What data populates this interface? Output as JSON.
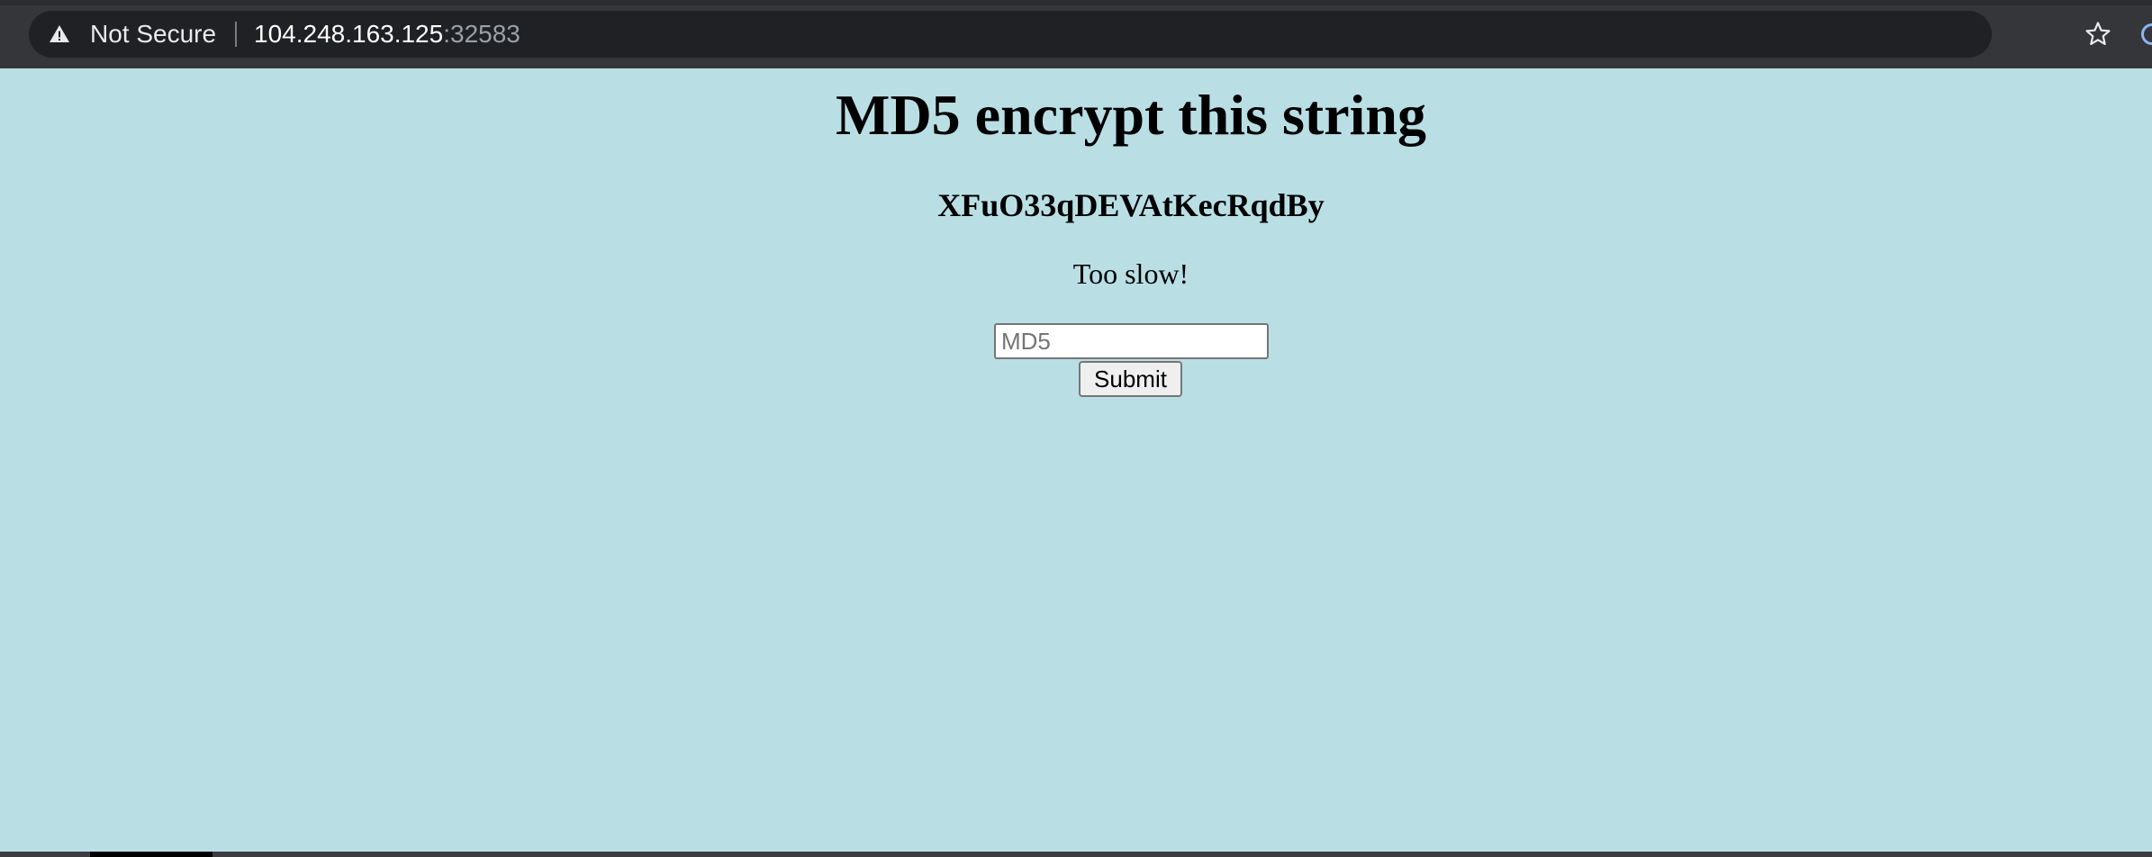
{
  "browser": {
    "security_label": "Not Secure",
    "url_host": "104.248.163.125",
    "url_port": ":32583",
    "icons": {
      "security": "warning-triangle-icon",
      "bookmark": "star-icon",
      "extension": "extension-icon"
    }
  },
  "page": {
    "background_color": "#b9dfe5",
    "heading": "MD5 encrypt this string",
    "challenge_string": "XFuO33qDEVAtKecRqdBy",
    "status_message": "Too slow!",
    "form": {
      "input_placeholder": "MD5",
      "input_value": "",
      "submit_label": "Submit"
    }
  }
}
